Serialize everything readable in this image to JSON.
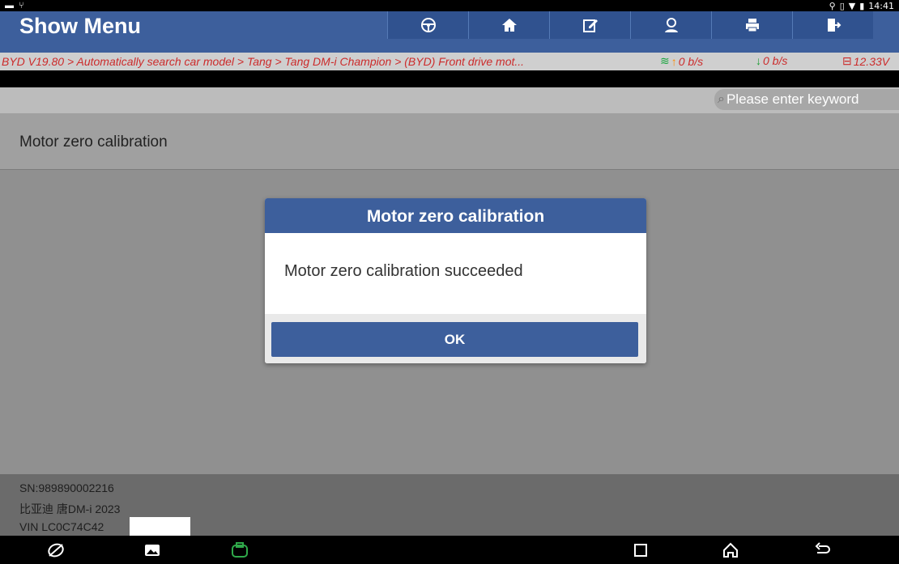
{
  "statusbar": {
    "time": "14:41"
  },
  "header": {
    "title": "Show Menu",
    "toolbar": [
      {
        "name": "steering-wheel-icon"
      },
      {
        "name": "home-icon"
      },
      {
        "name": "edit-icon"
      },
      {
        "name": "user-icon"
      },
      {
        "name": "print-icon"
      },
      {
        "name": "exit-icon"
      }
    ]
  },
  "breadcrumb": "BYD V19.80 > Automatically search car model > Tang > Tang DM-i Champion > (BYD) Front drive mot...",
  "network": {
    "up": "0 b/s",
    "down": "0 b/s",
    "voltage": "12.33V"
  },
  "search": {
    "placeholder": "Please enter keyword"
  },
  "menu": {
    "items": [
      {
        "label": "Motor zero calibration"
      }
    ]
  },
  "footer": {
    "sn": "SN:989890002216",
    "model": "比亚迪 唐DM-i 2023",
    "vin": "VIN LC0C74C42"
  },
  "dialog": {
    "title": "Motor zero calibration",
    "message": "Motor zero calibration succeeded",
    "ok_label": "OK"
  },
  "colors": {
    "header": "#3d5f9c",
    "breadcrumb": "#cc2b2b",
    "vci": "#2fa94a"
  }
}
